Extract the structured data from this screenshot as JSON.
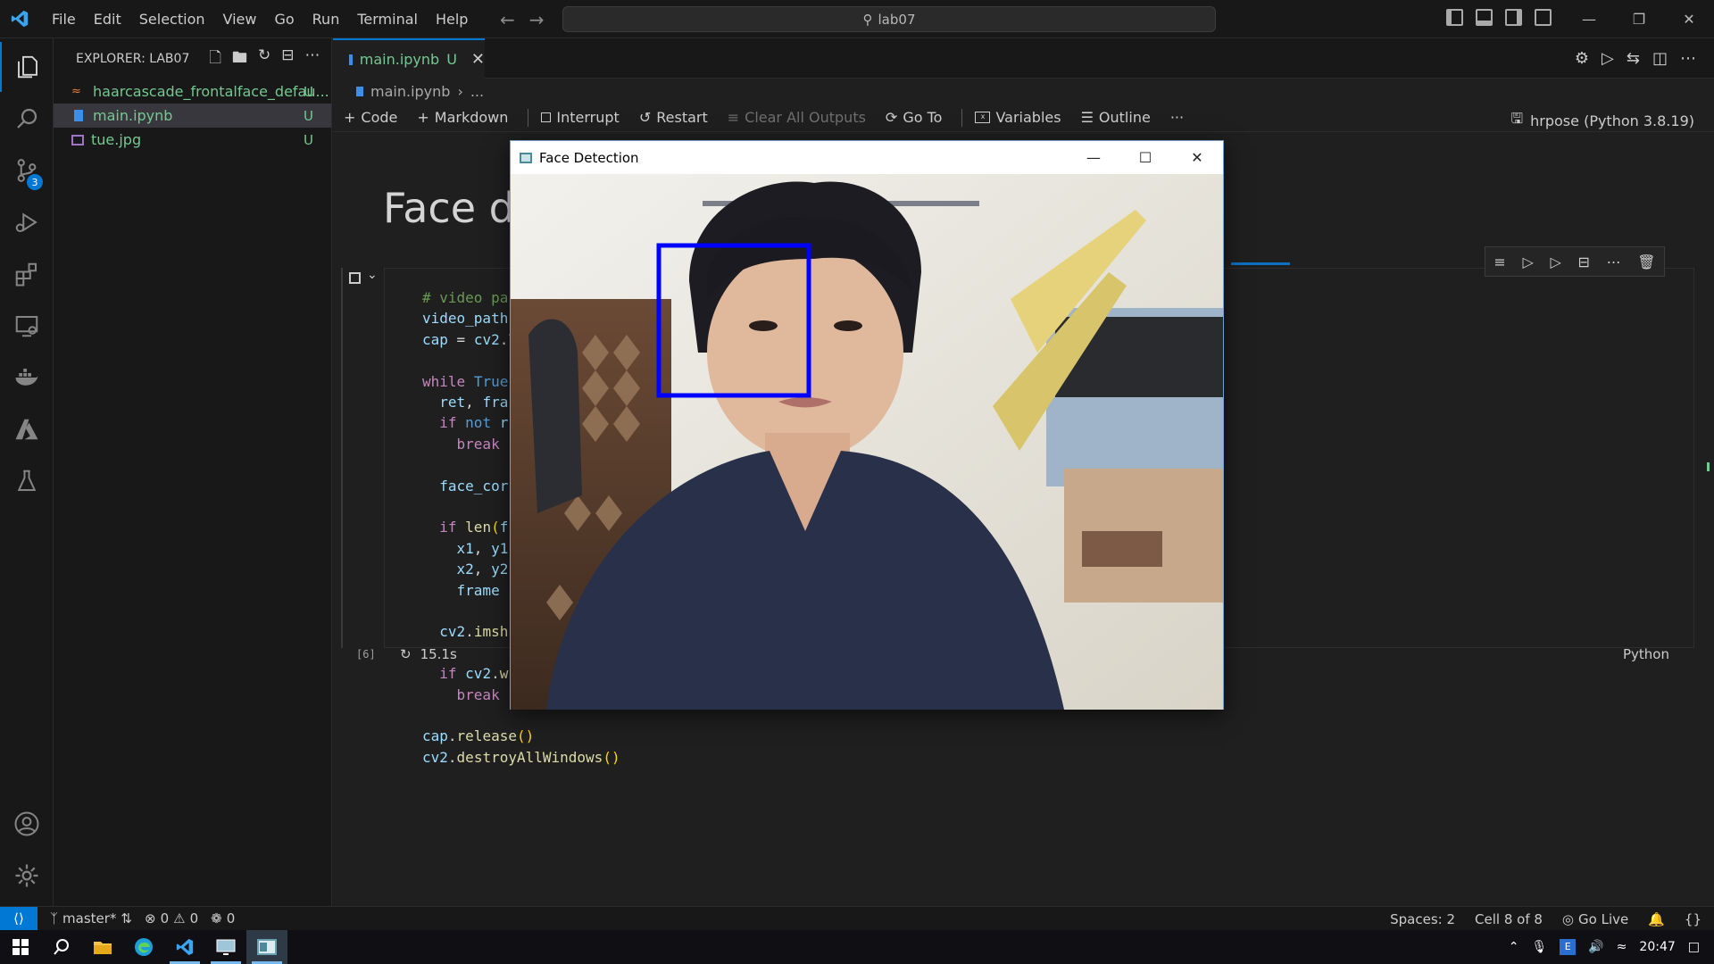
{
  "titlebar": {
    "menu": [
      "File",
      "Edit",
      "Selection",
      "View",
      "Go",
      "Run",
      "Terminal",
      "Help"
    ],
    "search_text": "lab07"
  },
  "explorer": {
    "title": "EXPLORER: LAB07",
    "files": [
      {
        "name": "haarcascade_frontalface_defau...",
        "status": "U",
        "icon": "rss-xml-icon"
      },
      {
        "name": "main.ipynb",
        "status": "U",
        "icon": "notebook-icon"
      },
      {
        "name": "tue.jpg",
        "status": "U",
        "icon": "image-icon"
      }
    ]
  },
  "activity": {
    "scm_badge": "3"
  },
  "tab": {
    "label": "main.ipynb",
    "status": "U"
  },
  "breadcrumb": {
    "file": "main.ipynb",
    "rest": "..."
  },
  "nbtoolbar": {
    "code": "Code",
    "markdown": "Markdown",
    "interrupt": "Interrupt",
    "restart": "Restart",
    "clear": "Clear All Outputs",
    "goto": "Go To",
    "variables": "Variables",
    "outline": "Outline",
    "more": "···",
    "kernel": "hrpose (Python 3.8.19)"
  },
  "notebook": {
    "heading": "Face de",
    "code_lines": [
      {
        "parts": [
          [
            "c-comment",
            "# video pa"
          ]
        ]
      },
      {
        "parts": [
          [
            "c-var",
            "video_path"
          ]
        ]
      },
      {
        "parts": [
          [
            "c-var",
            "cap"
          ],
          [
            "c-plain",
            " = "
          ],
          [
            "c-var",
            "cv2"
          ],
          [
            "c-plain",
            ".\\"
          ]
        ]
      },
      {
        "parts": []
      },
      {
        "parts": [
          [
            "c-kw",
            "while"
          ],
          [
            "c-plain",
            " "
          ],
          [
            "c-const",
            "True"
          ]
        ]
      },
      {
        "parts": [
          [
            "c-plain",
            "  "
          ],
          [
            "c-var",
            "ret"
          ],
          [
            "c-plain",
            ", "
          ],
          [
            "c-var",
            "fra"
          ]
        ]
      },
      {
        "parts": [
          [
            "c-plain",
            "  "
          ],
          [
            "c-kw",
            "if"
          ],
          [
            "c-plain",
            " "
          ],
          [
            "c-const",
            "not"
          ],
          [
            "c-plain",
            " "
          ],
          [
            "c-var",
            "r"
          ]
        ]
      },
      {
        "parts": [
          [
            "c-plain",
            "    "
          ],
          [
            "c-kw",
            "break"
          ]
        ]
      },
      {
        "parts": []
      },
      {
        "parts": [
          [
            "c-plain",
            "  "
          ],
          [
            "c-var",
            "face_cor"
          ]
        ]
      },
      {
        "parts": []
      },
      {
        "parts": [
          [
            "c-plain",
            "  "
          ],
          [
            "c-kw",
            "if"
          ],
          [
            "c-plain",
            " "
          ],
          [
            "c-fn",
            "len"
          ],
          [
            "c-paren",
            "("
          ],
          [
            "c-var",
            "f"
          ]
        ]
      },
      {
        "parts": [
          [
            "c-plain",
            "    "
          ],
          [
            "c-var",
            "x1"
          ],
          [
            "c-plain",
            ", "
          ],
          [
            "c-var",
            "y1"
          ]
        ]
      },
      {
        "parts": [
          [
            "c-plain",
            "    "
          ],
          [
            "c-var",
            "x2"
          ],
          [
            "c-plain",
            ", "
          ],
          [
            "c-var",
            "y2"
          ]
        ]
      },
      {
        "parts": [
          [
            "c-plain",
            "    "
          ],
          [
            "c-var",
            "frame"
          ]
        ]
      },
      {
        "parts": []
      },
      {
        "parts": [
          [
            "c-plain",
            "  "
          ],
          [
            "c-var",
            "cv2"
          ],
          [
            "c-plain",
            "."
          ],
          [
            "c-fn",
            "imsh"
          ]
        ]
      },
      {
        "parts": []
      },
      {
        "parts": [
          [
            "c-plain",
            "  "
          ],
          [
            "c-kw",
            "if"
          ],
          [
            "c-plain",
            " "
          ],
          [
            "c-var",
            "cv2"
          ],
          [
            "c-plain",
            "."
          ],
          [
            "c-fn",
            "w"
          ]
        ]
      },
      {
        "parts": [
          [
            "c-plain",
            "    "
          ],
          [
            "c-kw",
            "break"
          ]
        ]
      },
      {
        "parts": []
      },
      {
        "parts": [
          [
            "c-var",
            "cap"
          ],
          [
            "c-plain",
            "."
          ],
          [
            "c-fn",
            "release"
          ],
          [
            "c-paren",
            "()"
          ]
        ]
      },
      {
        "parts": [
          [
            "c-var",
            "cv2"
          ],
          [
            "c-plain",
            "."
          ],
          [
            "c-fn",
            "destroyAllWindows"
          ],
          [
            "c-paren",
            "()"
          ]
        ]
      }
    ],
    "exec_count": "[6]",
    "exec_time": "15.1s",
    "language": "Python"
  },
  "face_window": {
    "title": "Face Detection"
  },
  "statusbar": {
    "branch": "master*",
    "errors": "0",
    "warnings": "0",
    "ports": "0",
    "spaces": "Spaces: 2",
    "cell": "Cell 8 of 8",
    "golive": "Go Live"
  },
  "taskbar": {
    "time": "20:47"
  },
  "colors": {
    "accent": "#0078d4",
    "untracked": "#73c991",
    "face_box": "#0000ff"
  }
}
